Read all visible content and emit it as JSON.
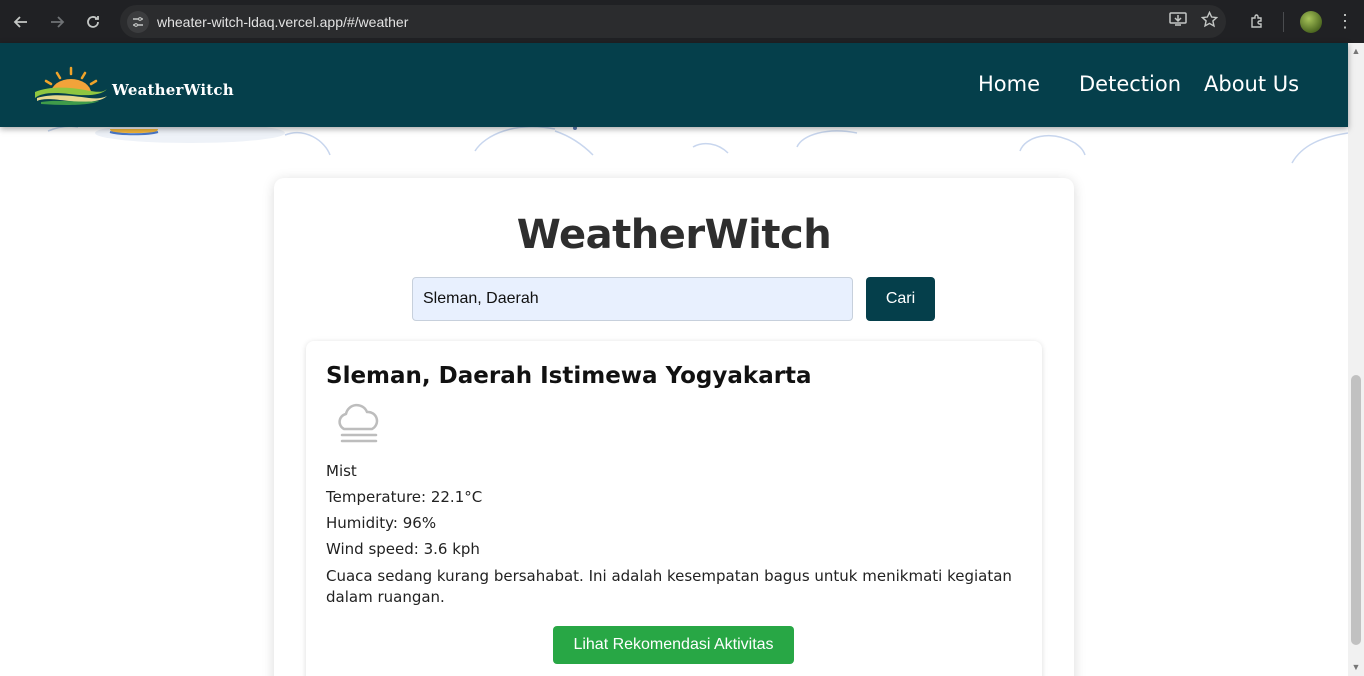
{
  "browser": {
    "url": "wheater-witch-ldaq.vercel.app/#/weather",
    "icons": [
      "back-arrow-icon",
      "forward-arrow-icon",
      "reload-icon",
      "site-info-icon",
      "install-app-icon",
      "bookmark-star-icon",
      "extensions-icon",
      "profile-avatar",
      "kebab-menu-icon"
    ]
  },
  "header": {
    "brand": "WeatherWitch",
    "nav": {
      "home": "Home",
      "detection": "Detection",
      "about": "About Us"
    },
    "colors": {
      "background": "#053f4b",
      "text": "#ffffff"
    }
  },
  "main": {
    "title": "WeatherWitch",
    "search": {
      "value": "Sleman, Daerah",
      "button_label": "Cari"
    },
    "result": {
      "location": "Sleman, Daerah Istimewa Yogyakarta",
      "icon": "mist-cloud-icon",
      "condition": "Mist",
      "temperature": "Temperature: 22.1°C",
      "humidity": "Humidity: 96%",
      "wind": "Wind speed: 3.6 kph",
      "description": "Cuaca sedang kurang bersahabat. Ini adalah kesempatan bagus untuk menikmati kegiatan dalam ruangan.",
      "recommendation_button": "Lihat Rekomendasi Aktivitas"
    },
    "colors": {
      "primary_button": "#053f4b",
      "recommendation_button": "#28a745",
      "input_bg": "#e8f0fe"
    }
  }
}
